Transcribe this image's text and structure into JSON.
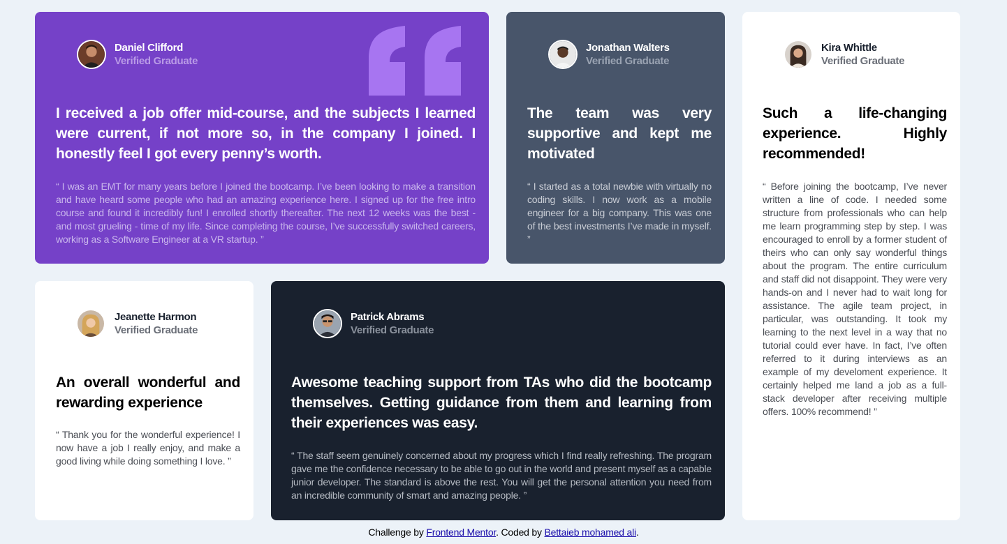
{
  "testimonials": [
    {
      "name": "Daniel Clifford",
      "role": "Verified Graduate",
      "headline": "I received a job offer mid-course, and the subjects I learned were current, if not more so, in the company I joined. I honestly feel I got every penny’s worth.",
      "body": "“ I was an EMT for many years before I joined the bootcamp. I’ve been looking to make a transition and have heard some people who had an amazing experience here. I signed up for the free intro course and found it incredibly fun! I enrolled shortly thereafter. The next 12 weeks was the best - and most grueling - time of my life. Since completing the course, I’ve successfully switched careers, working as a Software Engineer at a VR startup. ”",
      "color": "#7541c8"
    },
    {
      "name": "Jonathan Walters",
      "role": "Verified Graduate",
      "headline": "The team was very supportive and kept me motivated",
      "body": "“ I started as a total newbie with virtually no coding skills. I now work as a mobile engineer for a big company. This was one of the best investments I’ve made in myself. ”",
      "color": "#48556a"
    },
    {
      "name": "Kira Whittle",
      "role": "Verified Graduate",
      "headline": "Such a life-changing experience. Highly recommended!",
      "body": "“ Before joining the bootcamp, I’ve never written a line of code. I needed some structure from professionals who can help me learn programming step by step. I was encouraged to enroll by a former student of theirs who can only say wonderful things about the program. The entire curriculum and staff did not disappoint. They were very hands-on and I never had to wait long for assistance. The agile team project, in particular, was outstanding. It took my learning to the next level in a way that no tutorial could ever have. In fact, I’ve often referred to it during interviews as an example of my develoment experience. It certainly helped me land a job as a full-stack developer after receiving multiple offers. 100% recommend! ”",
      "color": "#ffffff"
    },
    {
      "name": "Jeanette Harmon",
      "role": "Verified Graduate",
      "headline": "An overall wonderful and rewarding experience",
      "body": "“ Thank you for the wonderful experience! I now have a job I really enjoy, and make a good living while doing something I love. ”",
      "color": "#ffffff"
    },
    {
      "name": "Patrick Abrams",
      "role": "Verified Graduate",
      "headline": "Awesome teaching support from TAs who did the bootcamp themselves. Getting guidance from them and learning from their experiences was easy.",
      "body": "“ The staff seem genuinely concerned about my progress which I find really refreshing. The program gave me the confidence necessary to be able to go out in the world and present myself as a capable junior developer. The standard is above the rest. You will get the personal attention you need from an incredible community of smart and amazing people. ”",
      "color": "#19212e"
    }
  ],
  "footer": {
    "prefix": "Challenge by ",
    "link1": "Frontend Mentor",
    "middle": ". Coded by ",
    "link2": "Bettaieb mohamed ali",
    "suffix": "."
  },
  "icons": {
    "quote": "quotation-mark-icon"
  }
}
